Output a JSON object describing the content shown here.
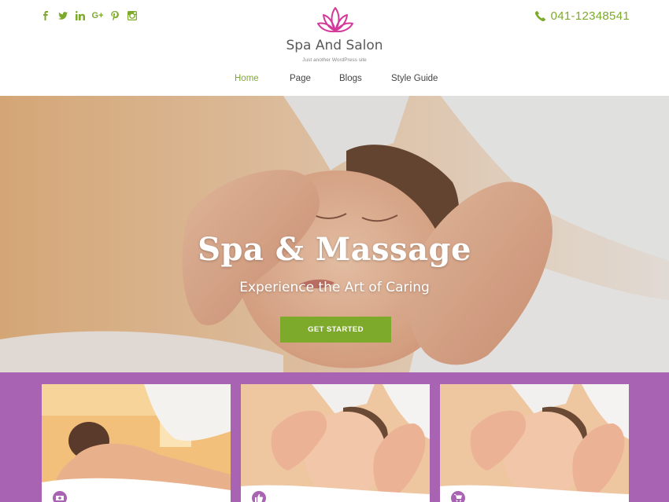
{
  "header": {
    "social": [
      {
        "name": "facebook-icon",
        "glyph": "f"
      },
      {
        "name": "twitter-icon",
        "glyph": "t"
      },
      {
        "name": "linkedin-icon",
        "glyph": "in"
      },
      {
        "name": "google-plus-icon",
        "glyph": "G+"
      },
      {
        "name": "pinterest-icon",
        "glyph": "p"
      },
      {
        "name": "instagram-icon",
        "glyph": "ig"
      }
    ],
    "phone": "041-12348541",
    "site_title": "Spa And Salon",
    "tagline": "Just another WordPress site"
  },
  "nav": {
    "items": [
      {
        "label": "Home",
        "active": true
      },
      {
        "label": "Page",
        "active": false
      },
      {
        "label": "Blogs",
        "active": false
      },
      {
        "label": "Style Guide",
        "active": false
      }
    ]
  },
  "hero": {
    "title": "Spa & Massage",
    "subtitle": "Experience the Art of Caring",
    "button_label": "GET STARTED"
  },
  "cards": [
    {
      "badge_icon": "money-icon"
    },
    {
      "badge_icon": "thumbs-up-icon"
    },
    {
      "badge_icon": "cart-icon"
    }
  ],
  "colors": {
    "accent_green": "#7daa2a",
    "band_purple": "#a864b2",
    "logo_pink": "#d4389a"
  }
}
